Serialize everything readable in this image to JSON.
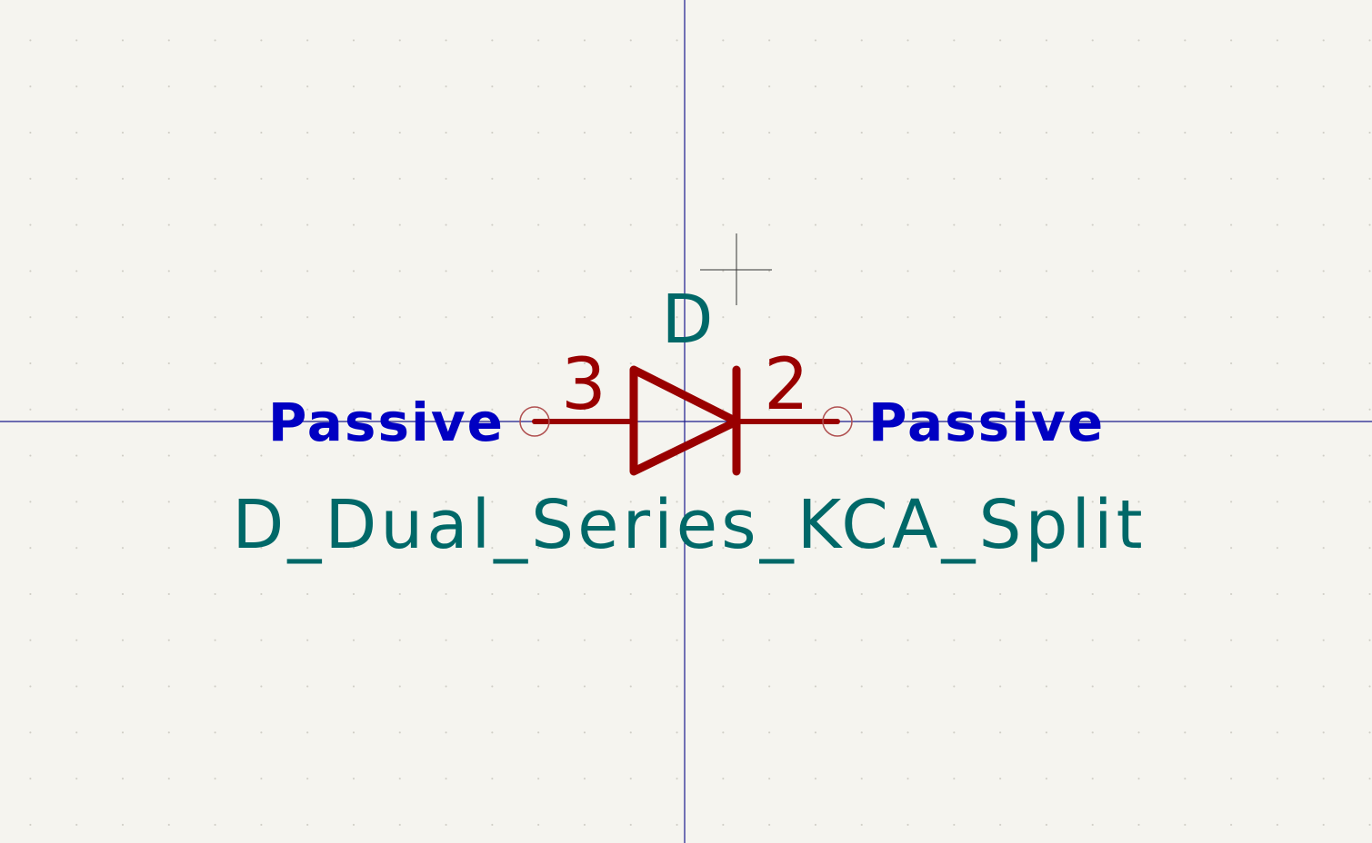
{
  "symbol": {
    "reference": "D",
    "value": "D_Dual_Series_KCA_Split",
    "pins": [
      {
        "number": "3",
        "electrical_type": "Passive"
      },
      {
        "number": "2",
        "electrical_type": "Passive"
      }
    ]
  },
  "colors": {
    "background": "#f5f4ef",
    "grid_dot": "#cfcdc5",
    "axis": "#1a1a8c",
    "body": "#990000",
    "pin_end": "#b05050",
    "field_text": "#006868",
    "pin_type_text": "#0000c2",
    "cursor": "#333333"
  }
}
